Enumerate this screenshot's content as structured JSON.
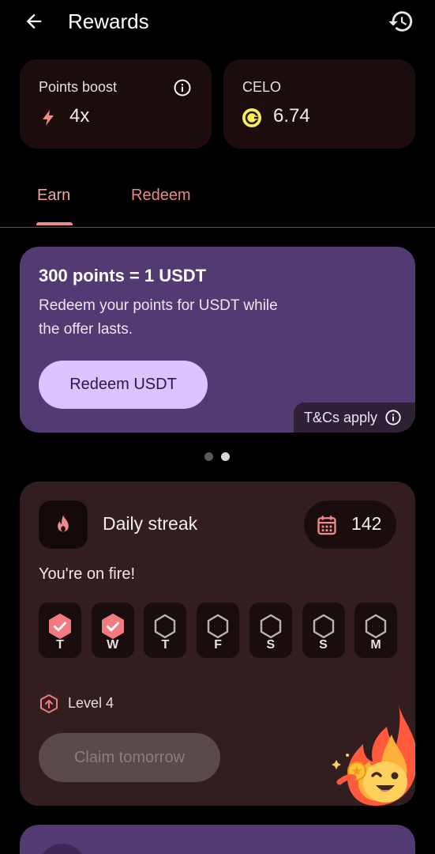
{
  "header": {
    "title": "Rewards",
    "back_icon": "arrow-left-icon",
    "history_icon": "history-icon"
  },
  "stats": {
    "points_boost": {
      "label": "Points boost",
      "value": "4x",
      "icon": "lightning-icon"
    },
    "celo": {
      "label": "CELO",
      "value": "6.74",
      "icon": "celo-coin-icon"
    }
  },
  "tabs": [
    {
      "label": "Earn",
      "selected": true
    },
    {
      "label": "Redeem",
      "selected": false
    }
  ],
  "promo": {
    "title": "300 points = 1 USDT",
    "description": "Redeem your points for USDT while the offer lasts.",
    "button_label": "Redeem USDT",
    "tcs_label": "T&Cs apply"
  },
  "carousel": {
    "total": 2,
    "active": 2
  },
  "streak": {
    "title": "Daily streak",
    "count": "142",
    "message": "You're on fire!",
    "days": [
      {
        "label": "T",
        "completed": true
      },
      {
        "label": "W",
        "completed": true
      },
      {
        "label": "T",
        "completed": false
      },
      {
        "label": "F",
        "completed": false
      },
      {
        "label": "S",
        "completed": false
      },
      {
        "label": "S",
        "completed": false
      },
      {
        "label": "M",
        "completed": false
      }
    ],
    "level": "Level 4",
    "claim_label": "Claim tomorrow"
  },
  "colors": {
    "accent": "#f28a8a",
    "promo_bg": "#533a73",
    "promo_button": "#dcc3ff",
    "streak_bg": "#321e1e"
  }
}
